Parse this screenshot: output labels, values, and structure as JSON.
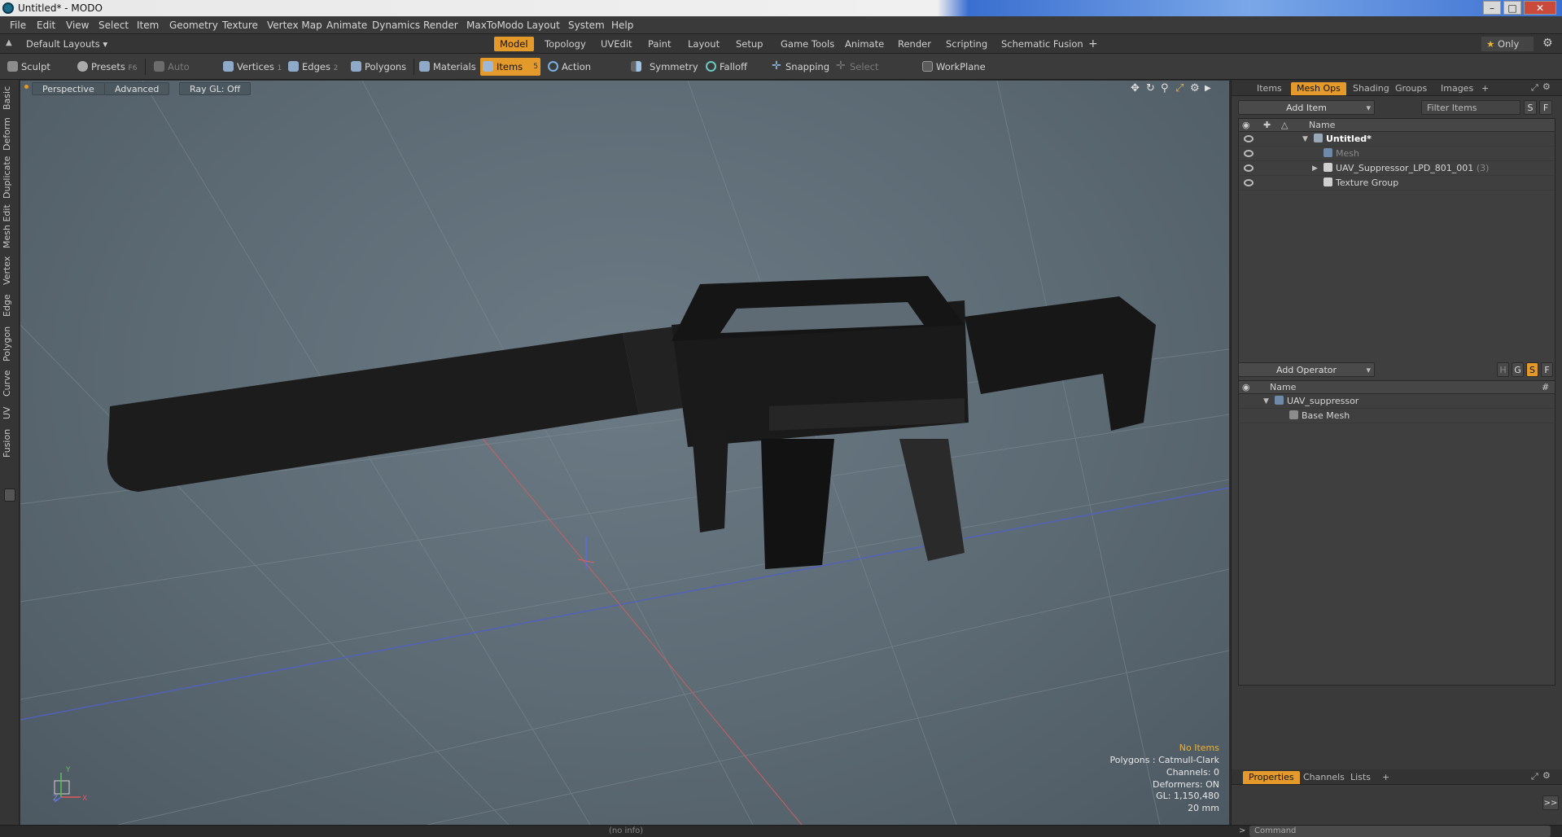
{
  "window": {
    "title": "Untitled* - MODO",
    "controls": [
      "–",
      "□",
      "✕"
    ]
  },
  "menu": [
    "File",
    "Edit",
    "View",
    "Select",
    "Item",
    "Geometry",
    "Texture",
    "Vertex Map",
    "Animate",
    "Dynamics",
    "Render",
    "MaxToModo",
    "Layout",
    "System",
    "Help"
  ],
  "layout": {
    "selector": "Default Layouts",
    "tabs": [
      "Model",
      "Topology",
      "UVEdit",
      "Paint",
      "Layout",
      "Setup",
      "Game Tools",
      "Animate",
      "Render",
      "Scripting",
      "Schematic Fusion"
    ],
    "active_tab": "Model",
    "add": "+",
    "only": "Only"
  },
  "toolbar": {
    "sculpt": "Sculpt",
    "presets": "Presets",
    "presets_key": "F6",
    "auto_select": "Auto Select",
    "vertices": "Vertices",
    "vertices_key": "1",
    "edges": "Edges",
    "edges_key": "2",
    "polygons": "Polygons",
    "materials": "Materials",
    "items": "Items",
    "items_key": "5",
    "action_center": "Action Center",
    "symmetry": "Symmetry",
    "falloff": "Falloff",
    "snapping": "Snapping",
    "select_through": "Select Through",
    "workplane": "WorkPlane"
  },
  "left_tabs": [
    "Basic",
    "Deform",
    "Duplicate",
    "Mesh Edit",
    "Vertex",
    "Edge",
    "Polygon",
    "Curve",
    "UV",
    "Fusion"
  ],
  "viewport": {
    "view": "Perspective",
    "shading": "Advanced",
    "raygl": "Ray GL: Off",
    "stats": {
      "no_items": "No Items",
      "polygons": "Polygons : Catmull-Clark",
      "channels": "Channels: 0",
      "deformers": "Deformers: ON",
      "gl": "GL: 1,150,480",
      "scale": "20 mm"
    },
    "axis": {
      "x": "X",
      "y": "Y",
      "z": "Z"
    }
  },
  "items_panel": {
    "tabs": [
      "Items",
      "Mesh Ops",
      "Shading",
      "Groups",
      "Images"
    ],
    "active_tab": "Mesh Ops",
    "add_item": "Add Item",
    "filter": "Filter Items",
    "s": "S",
    "f": "F",
    "col_name": "Name",
    "rows": [
      {
        "label": "Untitled*",
        "bold": true
      },
      {
        "label": "Mesh",
        "dim": true
      },
      {
        "label": "UAV_Suppressor_LPD_801_001",
        "count": "(3)"
      },
      {
        "label": "Texture Group"
      }
    ]
  },
  "meshops_panel": {
    "add_operator": "Add Operator",
    "btns": [
      "H",
      "G",
      "S",
      "F"
    ],
    "col_name": "Name",
    "col_hash": "#",
    "rows": [
      {
        "label": "UAV_suppressor"
      },
      {
        "label": "Base Mesh"
      }
    ]
  },
  "props_panel": {
    "tabs": [
      "Properties",
      "Channels",
      "Lists"
    ],
    "active_tab": "Properties",
    "add": "+",
    "expand": ">>"
  },
  "status": {
    "info": "(no info)",
    "command": "Command"
  }
}
